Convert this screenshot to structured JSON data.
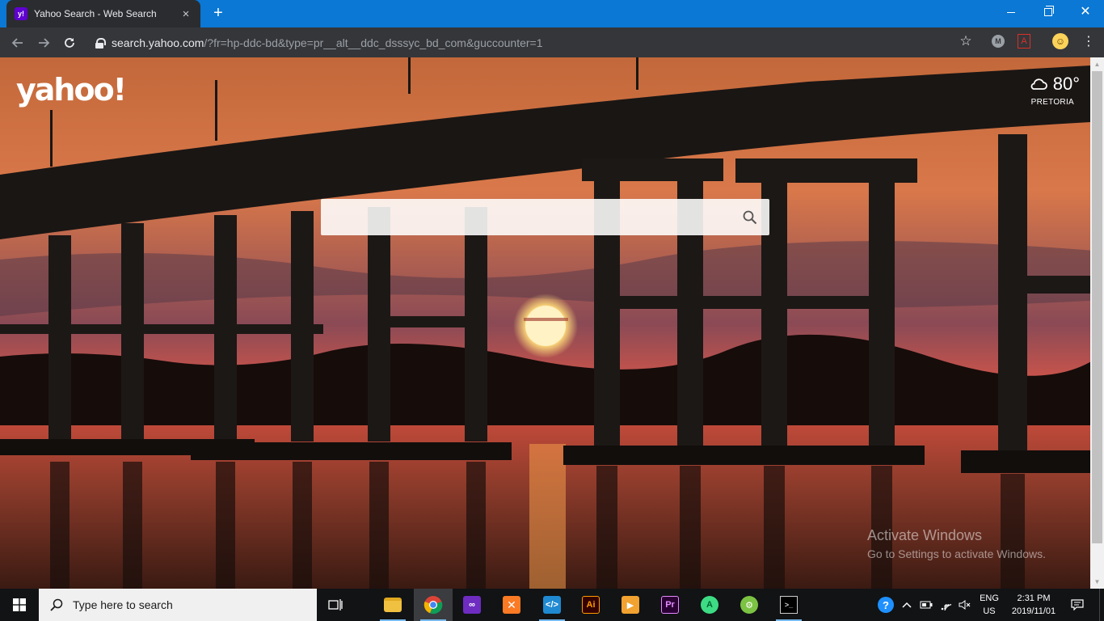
{
  "browser": {
    "tab": {
      "favicon_text": "y!",
      "title": "Yahoo Search - Web Search"
    },
    "new_tab_label": "+",
    "address": {
      "host": "search.yahoo.com",
      "path": "/?fr=hp-ddc-bd&type=pr__alt__ddc_dsssyc_bd_com&guccounter=1"
    },
    "extensions": {
      "m_badge": "M",
      "pdf_badge": "A"
    }
  },
  "page": {
    "logo": "yahoo!",
    "weather": {
      "temperature": "80°",
      "city": "PRETORIA"
    },
    "search": {
      "value": "",
      "placeholder": ""
    }
  },
  "watermark": {
    "line1": "Activate Windows",
    "line2": "Go to Settings to activate Windows."
  },
  "taskbar": {
    "search_placeholder": "Type here to search",
    "apps": [
      {
        "name": "file-explorer",
        "label": ""
      },
      {
        "name": "chrome",
        "label": ""
      },
      {
        "name": "visual-studio",
        "label": ""
      },
      {
        "name": "xampp",
        "label": ""
      },
      {
        "name": "vscode",
        "label": ""
      },
      {
        "name": "illustrator",
        "label": "Ai"
      },
      {
        "name": "media-player",
        "label": ""
      },
      {
        "name": "premiere",
        "label": "Pr"
      },
      {
        "name": "android-studio",
        "label": ""
      },
      {
        "name": "android-emulator",
        "label": ""
      },
      {
        "name": "terminal",
        "label": ""
      }
    ],
    "lang_line1": "ENG",
    "lang_line2": "US",
    "time": "2:31 PM",
    "date": "2019/11/01"
  },
  "colors": {
    "titlebar": "#0a78d4",
    "toolbar": "#35363a",
    "taskbar": "#111315",
    "yahoo_purple": "#6001d2"
  }
}
